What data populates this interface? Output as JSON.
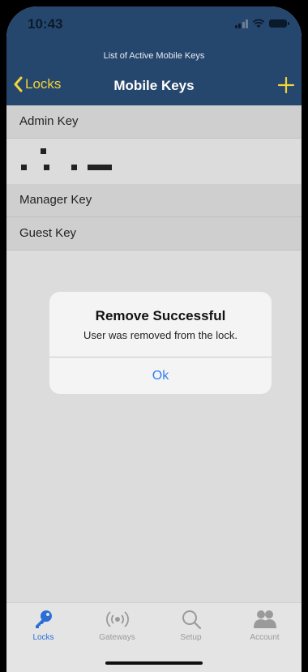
{
  "status_bar": {
    "time": "10:43"
  },
  "header": {
    "subtitle": "List of Active Mobile Keys",
    "back_label": "Locks",
    "title": "Mobile Keys"
  },
  "list": {
    "items": [
      {
        "label": "Admin Key"
      },
      {
        "label": "Manager Key"
      },
      {
        "label": "Guest Key"
      }
    ]
  },
  "alert": {
    "title": "Remove Successful",
    "message": "User was removed from the lock.",
    "ok_label": "Ok"
  },
  "tabbar": {
    "tabs": [
      {
        "label": "Locks",
        "icon": "key-icon",
        "active": true
      },
      {
        "label": "Gateways",
        "icon": "broadcast-icon",
        "active": false
      },
      {
        "label": "Setup",
        "icon": "search-icon",
        "active": false
      },
      {
        "label": "Account",
        "icon": "users-icon",
        "active": false
      }
    ]
  },
  "colors": {
    "header_bg": "#26476d",
    "accent_yellow": "#f0d43a",
    "active_tab": "#2b6fd6",
    "alert_button": "#2f7ff0"
  }
}
